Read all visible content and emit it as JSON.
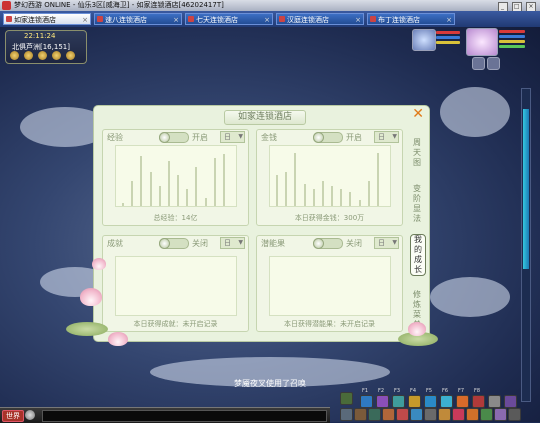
{
  "window": {
    "title": "梦幻西游 ONLINE - 仙乐3区[威海卫] - 如家连锁酒店[46202417T]",
    "controls": [
      "_",
      "□",
      "×"
    ]
  },
  "tabs": [
    {
      "label": "如家连锁酒店",
      "active": true
    },
    {
      "label": "速八连锁酒店",
      "active": false
    },
    {
      "label": "七天连锁酒店",
      "active": false
    },
    {
      "label": "汉庭连锁酒店",
      "active": false
    },
    {
      "label": "布丁连锁酒店",
      "active": false
    }
  ],
  "minimap": {
    "time": "22:11:24",
    "location": "北俱芦洲[16,151]"
  },
  "panel": {
    "title": "如家连锁酒店",
    "side_tabs": [
      {
        "label": "周 天 图",
        "active": false
      },
      {
        "label": "变 阶 显 法",
        "active": false
      },
      {
        "label": "我 的 成 长",
        "active": true
      },
      {
        "label": "修 炼 菜 单",
        "active": false
      }
    ],
    "sections": [
      {
        "label": "经验",
        "toggle_state": "开启",
        "dropdown": "日",
        "footer": "总经验：14亿",
        "bars": [
          0.05,
          0.45,
          0.9,
          0.6,
          0.35,
          0.8,
          0.55,
          0.3,
          0.7,
          0.15,
          0.85,
          0.92
        ]
      },
      {
        "label": "金钱",
        "toggle_state": "开启",
        "dropdown": "日",
        "footer": "本日获得金钱：300万",
        "bars": [
          0.55,
          0.6,
          0.95,
          0.4,
          0.3,
          0.45,
          0.35,
          0.3,
          0.25,
          0.1,
          0.45,
          0.95
        ]
      },
      {
        "label": "成就",
        "toggle_state": "关闭",
        "dropdown": "日",
        "footer": "本日获得成就：未开启记录",
        "bars": []
      },
      {
        "label": "潜能果",
        "toggle_state": "关闭",
        "dropdown": "日",
        "footer": "本日获得潜能果：未开启记录",
        "bars": []
      }
    ]
  },
  "message": "梦魇夜叉使用了召唤",
  "chat": {
    "channel_button": "世界"
  },
  "skillbar": {
    "fkeys": [
      "F1",
      "F2",
      "F3",
      "F4",
      "F5",
      "F6",
      "F7",
      "F8"
    ]
  },
  "colors": {
    "panel_bg": "#e9f2de",
    "accent_close": "#e07a18",
    "tab_active_bg": "#d7dfee",
    "tab_bg": "#234d95"
  }
}
